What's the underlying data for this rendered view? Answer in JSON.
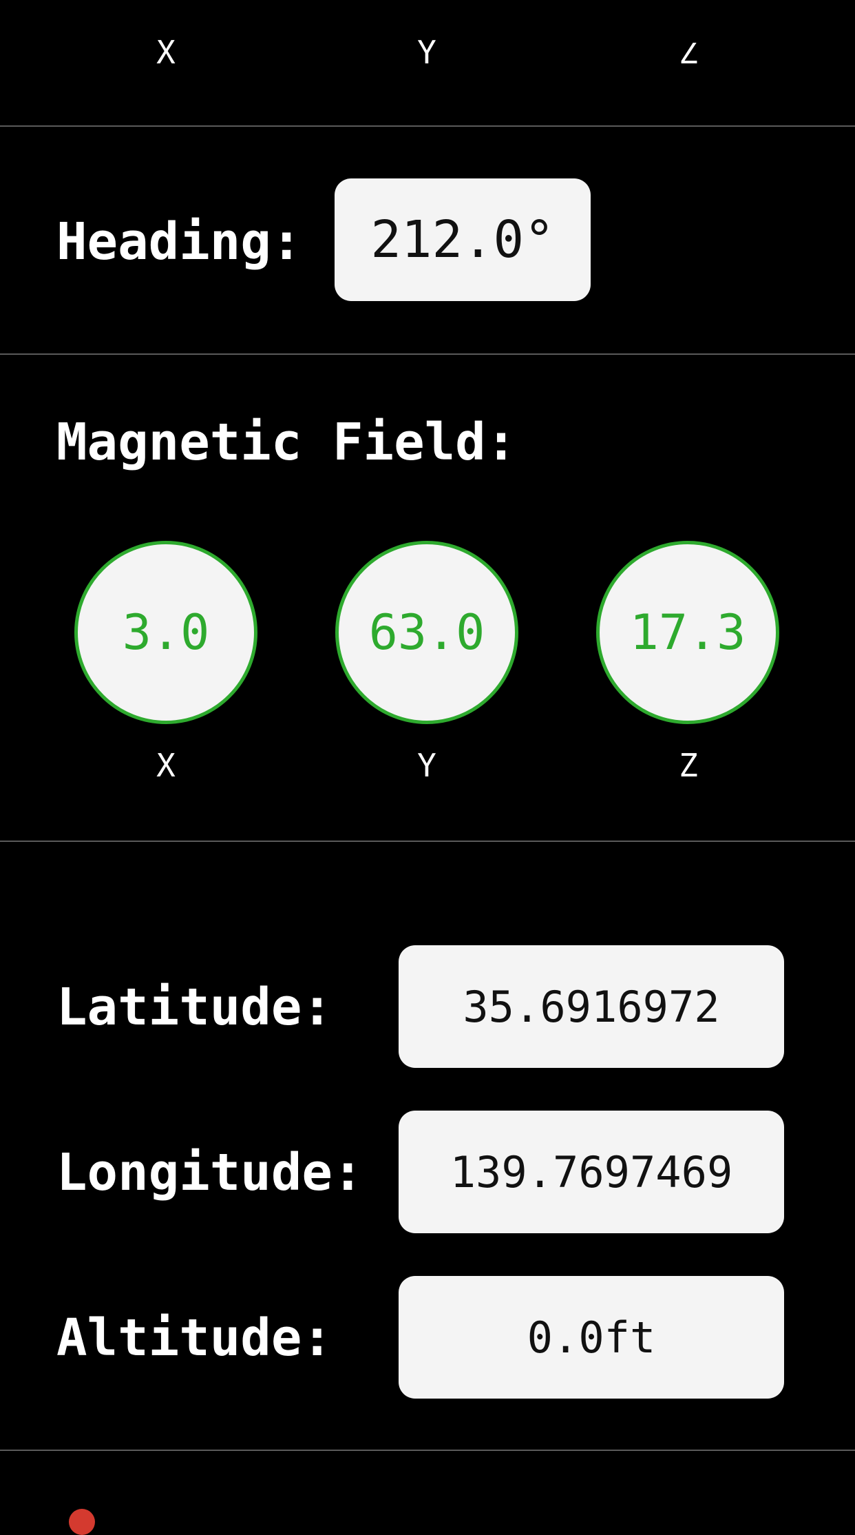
{
  "top_axes": {
    "x_label": "X",
    "y_label": "Y",
    "z_label": "Z"
  },
  "heading": {
    "label": "Heading:",
    "value": "212.0°"
  },
  "magnetic_field": {
    "title": "Magnetic Field:",
    "x_value": "3.0",
    "y_value": "63.0",
    "z_value": "17.3",
    "x_label": "X",
    "y_label": "Y",
    "z_label": "Z",
    "accent_color": "#2eaa2e"
  },
  "location": {
    "latitude_label": "Latitude:",
    "latitude_value": "35.6916972",
    "longitude_label": "Longitude:",
    "longitude_value": "139.7697469",
    "altitude_label": "Altitude:",
    "altitude_value": "0.0ft"
  },
  "bottom": {
    "icon": "location-pin-icon"
  }
}
